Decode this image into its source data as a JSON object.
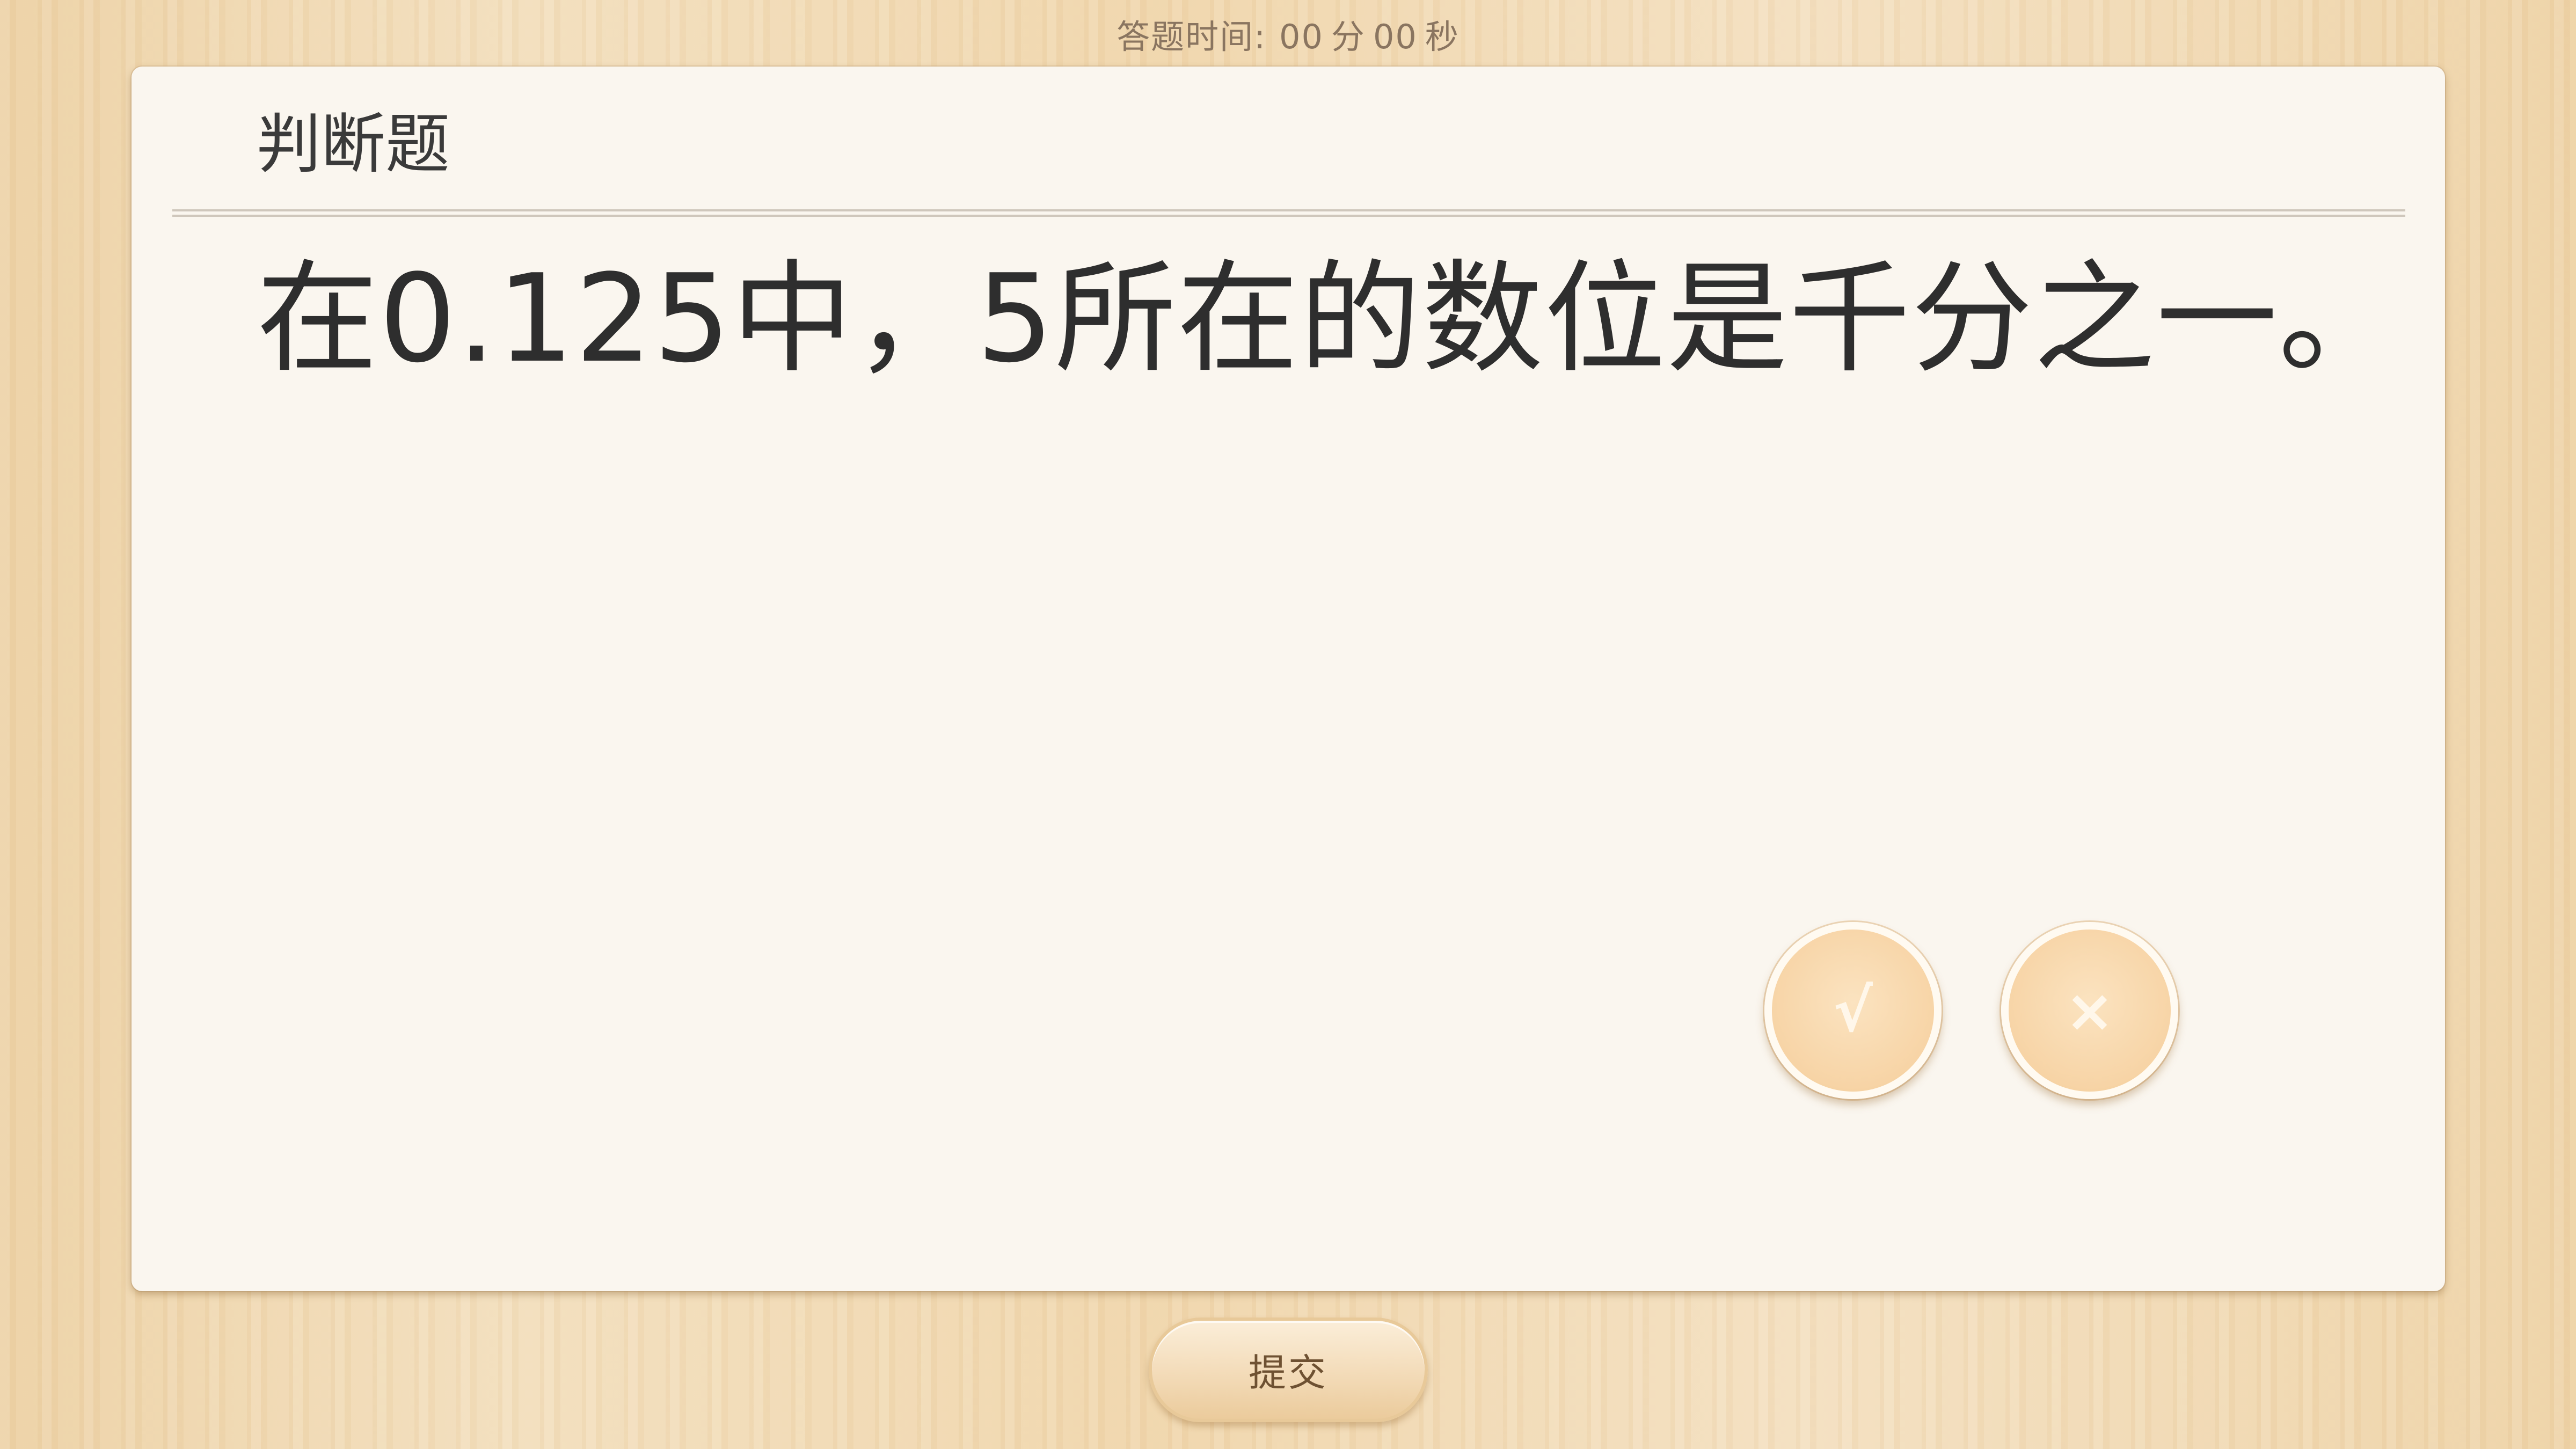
{
  "timer": {
    "label": "答题时间:",
    "minutes": "00",
    "minutes_unit": "分",
    "seconds": "00",
    "seconds_unit": "秒"
  },
  "question": {
    "type_title": "判断题",
    "text": "在0.125中，5所在的数位是千分之一。"
  },
  "answers": {
    "true_symbol": "√",
    "false_symbol": "×"
  },
  "actions": {
    "submit_label": "提交"
  }
}
